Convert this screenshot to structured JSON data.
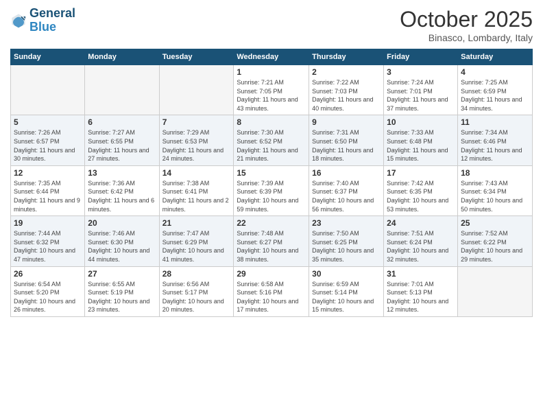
{
  "logo": {
    "line1": "General",
    "line2": "Blue"
  },
  "title": "October 2025",
  "subtitle": "Binasco, Lombardy, Italy",
  "weekdays": [
    "Sunday",
    "Monday",
    "Tuesday",
    "Wednesday",
    "Thursday",
    "Friday",
    "Saturday"
  ],
  "weeks": [
    [
      {
        "day": "",
        "info": ""
      },
      {
        "day": "",
        "info": ""
      },
      {
        "day": "",
        "info": ""
      },
      {
        "day": "1",
        "info": "Sunrise: 7:21 AM\nSunset: 7:05 PM\nDaylight: 11 hours and 43 minutes."
      },
      {
        "day": "2",
        "info": "Sunrise: 7:22 AM\nSunset: 7:03 PM\nDaylight: 11 hours and 40 minutes."
      },
      {
        "day": "3",
        "info": "Sunrise: 7:24 AM\nSunset: 7:01 PM\nDaylight: 11 hours and 37 minutes."
      },
      {
        "day": "4",
        "info": "Sunrise: 7:25 AM\nSunset: 6:59 PM\nDaylight: 11 hours and 34 minutes."
      }
    ],
    [
      {
        "day": "5",
        "info": "Sunrise: 7:26 AM\nSunset: 6:57 PM\nDaylight: 11 hours and 30 minutes."
      },
      {
        "day": "6",
        "info": "Sunrise: 7:27 AM\nSunset: 6:55 PM\nDaylight: 11 hours and 27 minutes."
      },
      {
        "day": "7",
        "info": "Sunrise: 7:29 AM\nSunset: 6:53 PM\nDaylight: 11 hours and 24 minutes."
      },
      {
        "day": "8",
        "info": "Sunrise: 7:30 AM\nSunset: 6:52 PM\nDaylight: 11 hours and 21 minutes."
      },
      {
        "day": "9",
        "info": "Sunrise: 7:31 AM\nSunset: 6:50 PM\nDaylight: 11 hours and 18 minutes."
      },
      {
        "day": "10",
        "info": "Sunrise: 7:33 AM\nSunset: 6:48 PM\nDaylight: 11 hours and 15 minutes."
      },
      {
        "day": "11",
        "info": "Sunrise: 7:34 AM\nSunset: 6:46 PM\nDaylight: 11 hours and 12 minutes."
      }
    ],
    [
      {
        "day": "12",
        "info": "Sunrise: 7:35 AM\nSunset: 6:44 PM\nDaylight: 11 hours and 9 minutes."
      },
      {
        "day": "13",
        "info": "Sunrise: 7:36 AM\nSunset: 6:42 PM\nDaylight: 11 hours and 6 minutes."
      },
      {
        "day": "14",
        "info": "Sunrise: 7:38 AM\nSunset: 6:41 PM\nDaylight: 11 hours and 2 minutes."
      },
      {
        "day": "15",
        "info": "Sunrise: 7:39 AM\nSunset: 6:39 PM\nDaylight: 10 hours and 59 minutes."
      },
      {
        "day": "16",
        "info": "Sunrise: 7:40 AM\nSunset: 6:37 PM\nDaylight: 10 hours and 56 minutes."
      },
      {
        "day": "17",
        "info": "Sunrise: 7:42 AM\nSunset: 6:35 PM\nDaylight: 10 hours and 53 minutes."
      },
      {
        "day": "18",
        "info": "Sunrise: 7:43 AM\nSunset: 6:34 PM\nDaylight: 10 hours and 50 minutes."
      }
    ],
    [
      {
        "day": "19",
        "info": "Sunrise: 7:44 AM\nSunset: 6:32 PM\nDaylight: 10 hours and 47 minutes."
      },
      {
        "day": "20",
        "info": "Sunrise: 7:46 AM\nSunset: 6:30 PM\nDaylight: 10 hours and 44 minutes."
      },
      {
        "day": "21",
        "info": "Sunrise: 7:47 AM\nSunset: 6:29 PM\nDaylight: 10 hours and 41 minutes."
      },
      {
        "day": "22",
        "info": "Sunrise: 7:48 AM\nSunset: 6:27 PM\nDaylight: 10 hours and 38 minutes."
      },
      {
        "day": "23",
        "info": "Sunrise: 7:50 AM\nSunset: 6:25 PM\nDaylight: 10 hours and 35 minutes."
      },
      {
        "day": "24",
        "info": "Sunrise: 7:51 AM\nSunset: 6:24 PM\nDaylight: 10 hours and 32 minutes."
      },
      {
        "day": "25",
        "info": "Sunrise: 7:52 AM\nSunset: 6:22 PM\nDaylight: 10 hours and 29 minutes."
      }
    ],
    [
      {
        "day": "26",
        "info": "Sunrise: 6:54 AM\nSunset: 5:20 PM\nDaylight: 10 hours and 26 minutes."
      },
      {
        "day": "27",
        "info": "Sunrise: 6:55 AM\nSunset: 5:19 PM\nDaylight: 10 hours and 23 minutes."
      },
      {
        "day": "28",
        "info": "Sunrise: 6:56 AM\nSunset: 5:17 PM\nDaylight: 10 hours and 20 minutes."
      },
      {
        "day": "29",
        "info": "Sunrise: 6:58 AM\nSunset: 5:16 PM\nDaylight: 10 hours and 17 minutes."
      },
      {
        "day": "30",
        "info": "Sunrise: 6:59 AM\nSunset: 5:14 PM\nDaylight: 10 hours and 15 minutes."
      },
      {
        "day": "31",
        "info": "Sunrise: 7:01 AM\nSunset: 5:13 PM\nDaylight: 10 hours and 12 minutes."
      },
      {
        "day": "",
        "info": ""
      }
    ]
  ]
}
